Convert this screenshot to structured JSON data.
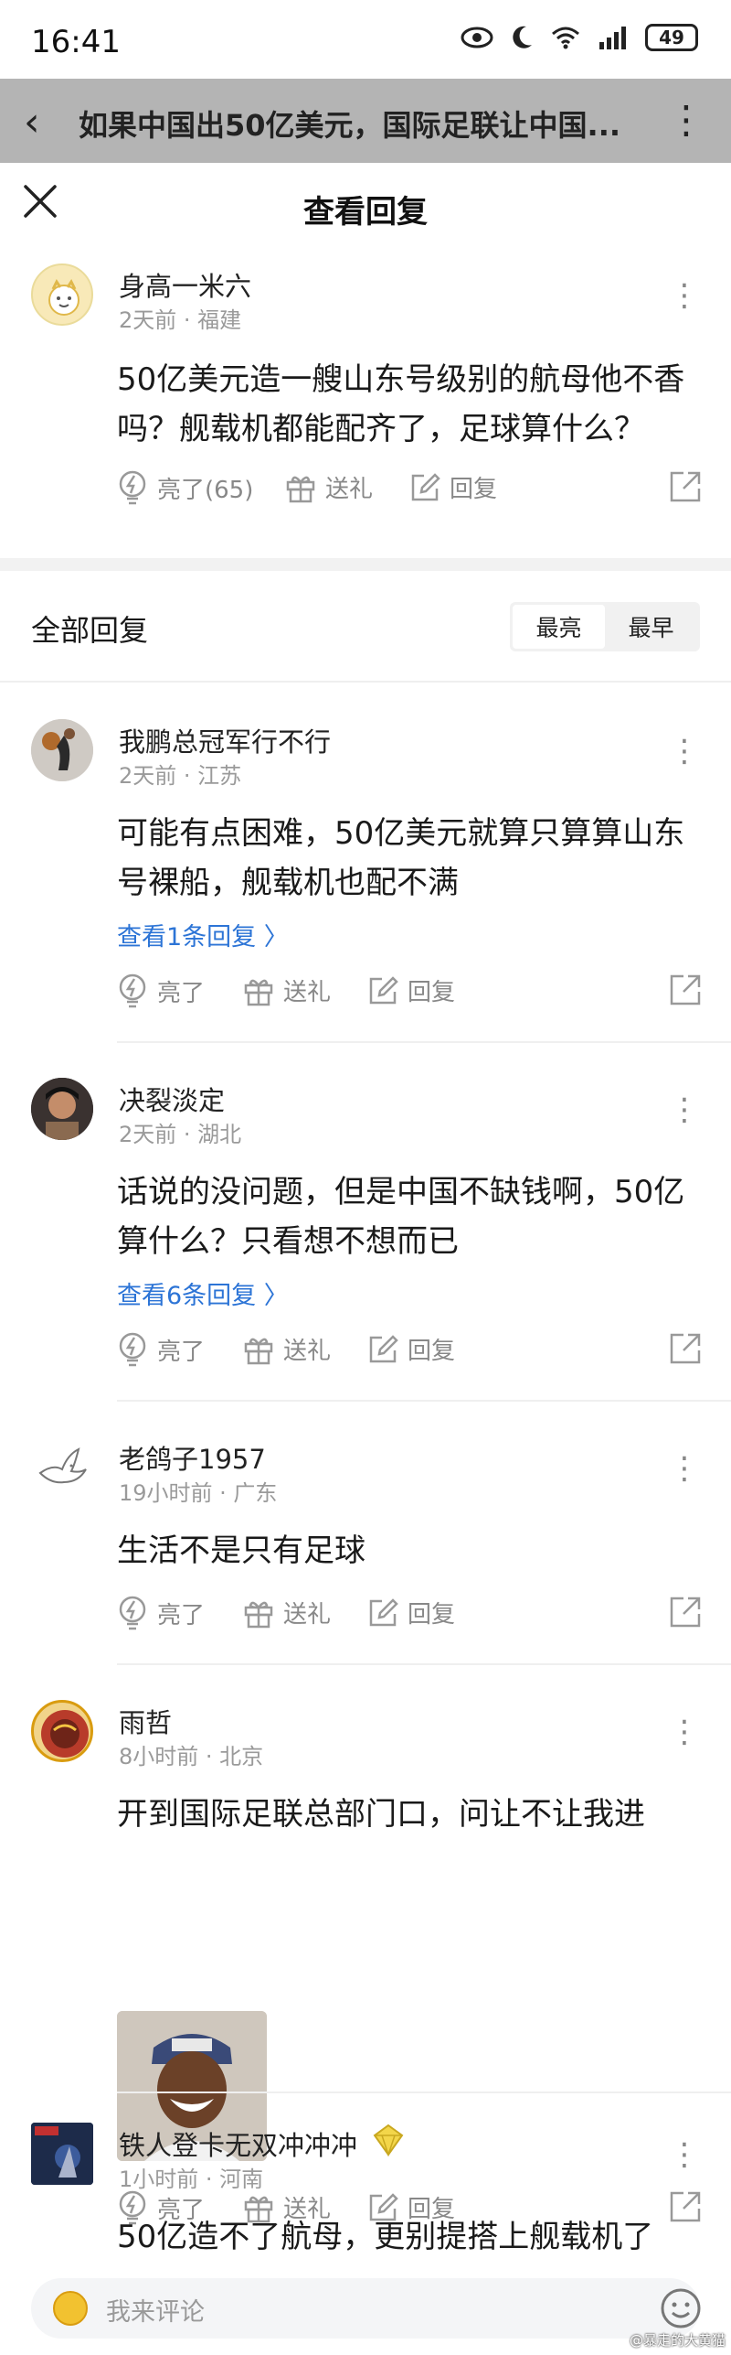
{
  "status_bar": {
    "time": "16:41",
    "battery": "49"
  },
  "article": {
    "title": "如果中国出50亿美元，国际足联让中国..."
  },
  "sheet": {
    "title": "查看回复"
  },
  "top_comment": {
    "name": "身高一米六",
    "meta": "2天前 · 福建",
    "text_line1": "50亿美元造一艘山东号级别的航母他不香",
    "text_line2": "吗？舰载机都能配齐了，足球算什么？",
    "like_label": "亮了(65)",
    "gift_label": "送礼",
    "reply_label": "回复"
  },
  "section": {
    "title": "全部回复",
    "sort_hot": "最亮",
    "sort_early": "最早"
  },
  "comments": [
    {
      "name": "我鹏总冠军行不行",
      "meta": "2天前 · 江苏",
      "line1": "可能有点困难，50亿美元就算只算算山东",
      "line2": "号裸船，舰载机也配不满",
      "view_replies": "查看1条回复 〉",
      "like_label": "亮了",
      "gift_label": "送礼",
      "reply_label": "回复"
    },
    {
      "name": "决裂淡定",
      "meta": "2天前 · 湖北",
      "line1": "话说的没问题，但是中国不缺钱啊，50亿",
      "line2": "算什么？只看想不想而已",
      "view_replies": "查看6条回复 〉",
      "like_label": "亮了",
      "gift_label": "送礼",
      "reply_label": "回复"
    },
    {
      "name": "老鸽子1957",
      "meta": "19小时前 · 广东",
      "line1": "生活不是只有足球",
      "like_label": "亮了",
      "gift_label": "送礼",
      "reply_label": "回复"
    },
    {
      "name": "雨哲",
      "meta": "8小时前 · 北京",
      "line1": "开到国际足联总部门口，问让不让我进",
      "like_label": "亮了",
      "gift_label": "送礼",
      "reply_label": "回复"
    },
    {
      "name": "铁人登卡无双冲冲冲",
      "meta": "1小时前 · 河南",
      "line1": "50亿造不了航母，更别提搭上舰载机了"
    }
  ],
  "input": {
    "placeholder": "我来评论"
  },
  "watermark": "@暴走的大黄猫",
  "colors": {
    "link": "#2c74d6",
    "header_dim": "#b4b4b4"
  }
}
